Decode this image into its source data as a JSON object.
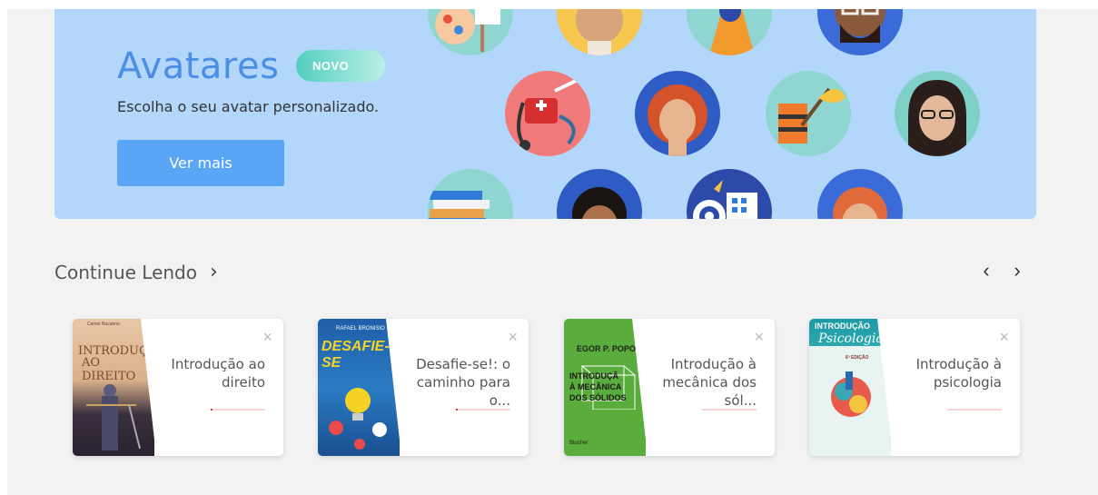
{
  "banner": {
    "title": "Avatares",
    "badge": "NOVO",
    "subtitle": "Escolha o seu avatar personalizado.",
    "button_label": "Ver mais"
  },
  "section": {
    "title": "Continue Lendo",
    "chevron": "›",
    "prev": "‹",
    "next": "›"
  },
  "cards": [
    {
      "title": "Introdução ao direito",
      "close": "×",
      "progress": 0.03,
      "cover": {
        "author": "Camoi Nucanno",
        "title_top": "INTRODUÇÃ",
        "title_bottom": "AO DIREITO"
      }
    },
    {
      "title": "Desafie-se!: o caminho para o...",
      "close": "×",
      "progress": 0.03,
      "cover": {
        "author": "RAFAEL BRONISIO",
        "title_top": "DESAFIE-SE"
      }
    },
    {
      "title": "Introdução à mecânica dos sól...",
      "close": "×",
      "progress": 0,
      "cover": {
        "author": "EGOR P. POPOV",
        "line1": "INTRODUÇÃ",
        "line2": "À MECÂNICA",
        "line3": "DOS SÓLIDOS",
        "publisher": "Blucher"
      }
    },
    {
      "title": "Introdução à psicologia",
      "close": "×",
      "progress": 0,
      "cover": {
        "title_top": "INTRODUÇÃO",
        "title_script": "Psicologia",
        "edition": "6ª EDIÇÃO"
      }
    }
  ],
  "colors": {
    "banner_bg": "#b3d6fb",
    "accent": "#4a8ee6",
    "button": "#58a6f5",
    "badge": "#52cfc0",
    "progress": "#d23a3a"
  }
}
